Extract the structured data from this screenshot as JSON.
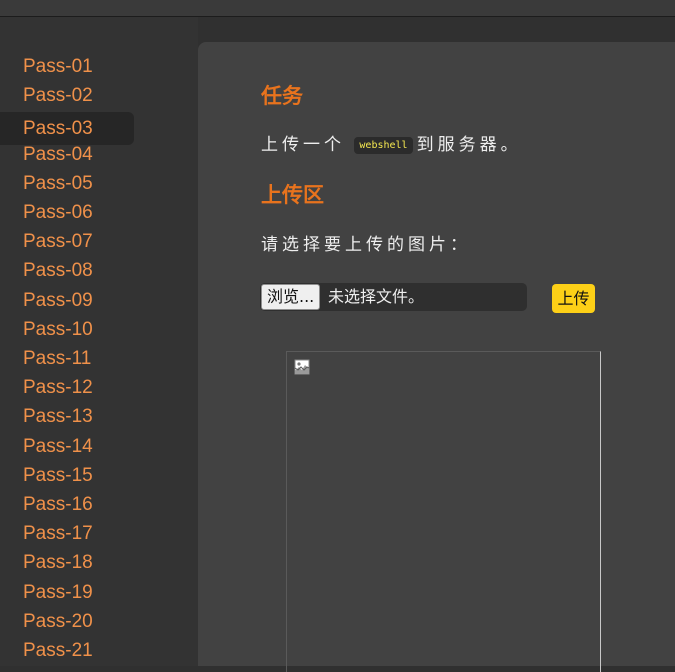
{
  "sidebar": {
    "items": [
      {
        "label": "Pass-01"
      },
      {
        "label": "Pass-02"
      },
      {
        "label": "Pass-03",
        "active": true
      },
      {
        "label": "Pass-04"
      },
      {
        "label": "Pass-05"
      },
      {
        "label": "Pass-06"
      },
      {
        "label": "Pass-07"
      },
      {
        "label": "Pass-08"
      },
      {
        "label": "Pass-09"
      },
      {
        "label": "Pass-10"
      },
      {
        "label": "Pass-11"
      },
      {
        "label": "Pass-12"
      },
      {
        "label": "Pass-13"
      },
      {
        "label": "Pass-14"
      },
      {
        "label": "Pass-15"
      },
      {
        "label": "Pass-16"
      },
      {
        "label": "Pass-17"
      },
      {
        "label": "Pass-18"
      },
      {
        "label": "Pass-19"
      },
      {
        "label": "Pass-20"
      },
      {
        "label": "Pass-21"
      }
    ]
  },
  "task": {
    "title": "任务",
    "text_before": "上传一个",
    "code": "webshell",
    "text_after": "到服务器。"
  },
  "upload": {
    "title": "上传区",
    "prompt": "请选择要上传的图片：",
    "browse_label": "浏览...",
    "file_status": "未选择文件。",
    "submit_label": "上传"
  },
  "preview": {
    "icon": "broken-image-icon"
  },
  "colors": {
    "accent": "#e8731d",
    "nav_link": "#f0914a",
    "submit": "#fdd017",
    "code": "#f5e850"
  }
}
